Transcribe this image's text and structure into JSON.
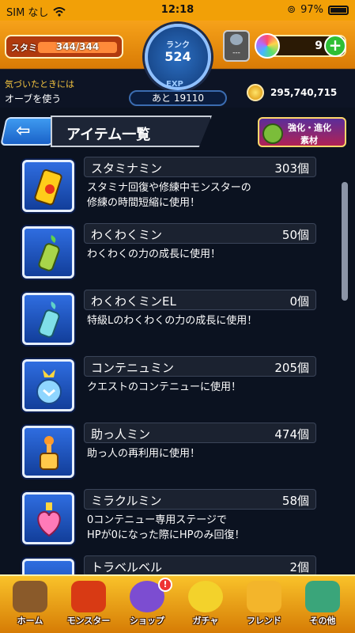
{
  "status_bar": {
    "carrier": "SIM なし",
    "time": "12:18",
    "battery": "97%"
  },
  "header": {
    "stamina_label": "スタミナ",
    "stamina_value": "344/344",
    "stamina_fill": 1.0,
    "rank_label": "ランク",
    "rank_value": "524",
    "exp_label": "EXP",
    "exp_remaining": "あと 19110",
    "device_text": "---",
    "orb_count": "9",
    "plus_label": "+",
    "hint_line1": "気づいたときには",
    "hint_line2": "オーブを使う",
    "gold_value": "295,740,715"
  },
  "titlebar": {
    "title": "アイテム一覧",
    "back_arrow": "⇦",
    "kyouka_line1": "強化・進化",
    "kyouka_line2": "素材"
  },
  "items": [
    {
      "name": "スタミナミン",
      "count": "303個",
      "desc": "スタミナ回復や修練中モンスターの\n修練の時間短縮に使用！",
      "icon": "can-icon"
    },
    {
      "name": "わくわくミン",
      "count": "50個",
      "desc": "わくわくの力の成長に使用！",
      "icon": "bottle-icon"
    },
    {
      "name": "わくわくミンEL",
      "count": "0個",
      "desc": "特級Lのわくわくの力の成長に使用！",
      "icon": "bottle-el-icon"
    },
    {
      "name": "コンテニュミン",
      "count": "205個",
      "desc": "クエストのコンテニューに使用！",
      "icon": "continue-orb-icon"
    },
    {
      "name": "助っ人ミン",
      "count": "474個",
      "desc": "助っ人の再利用に使用！",
      "icon": "helper-icon"
    },
    {
      "name": "ミラクルミン",
      "count": "58個",
      "desc": "0コンテニュー専用ステージで\nHPが0になった際にHPのみ回復！",
      "icon": "heart-bottle-icon"
    },
    {
      "name": "トラベルベル",
      "count": "2個",
      "desc": "",
      "icon": "bell-icon"
    }
  ],
  "nav": [
    {
      "label": "ホーム",
      "icon": "home-icon",
      "color": "#8a5a2a"
    },
    {
      "label": "モンスター",
      "icon": "monster-icon",
      "color": "#d83a14"
    },
    {
      "label": "ショップ",
      "icon": "orb-shop-icon",
      "color": "#7c4dd1",
      "badge": "!"
    },
    {
      "label": "ガチャ",
      "icon": "gacha-icon",
      "color": "#f3d22b"
    },
    {
      "label": "フレンド",
      "icon": "friend-icon",
      "color": "#f3b52b"
    },
    {
      "label": "その他",
      "icon": "other-icon",
      "color": "#3aa57a"
    }
  ]
}
